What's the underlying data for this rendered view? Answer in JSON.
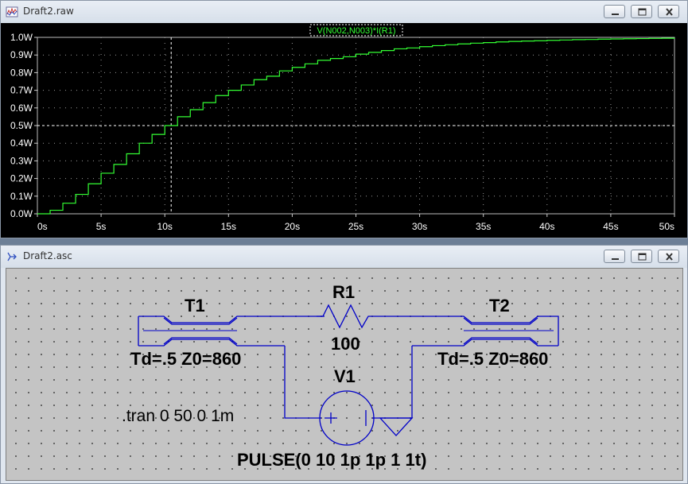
{
  "plot_window": {
    "title": "Draft2.raw",
    "trace_label": "V(N002,N003)*I(R1)",
    "colors": {
      "background": "#000000",
      "trace": "#33ff33",
      "axis_text": "#ffffff",
      "grid": "#9a9a9a"
    }
  },
  "chart_data": {
    "type": "line",
    "title": "",
    "xlabel": "",
    "ylabel": "",
    "xlim": [
      0,
      50
    ],
    "ylim": [
      0,
      1.0
    ],
    "x_ticks": [
      "0s",
      "5s",
      "10s",
      "15s",
      "20s",
      "25s",
      "30s",
      "35s",
      "40s",
      "45s",
      "50s"
    ],
    "y_ticks": [
      "0.0W",
      "0.1W",
      "0.2W",
      "0.3W",
      "0.4W",
      "0.5W",
      "0.6W",
      "0.7W",
      "0.8W",
      "0.9W",
      "1.0W"
    ],
    "grid": true,
    "cursor_x": 10.5,
    "cursor_y": 0.5,
    "series": [
      {
        "name": "V(N002,N003)*I(R1)",
        "color": "#33ff33",
        "x": [
          0,
          1,
          2,
          3,
          4,
          5,
          6,
          7,
          8,
          9,
          10,
          11,
          12,
          13,
          14,
          15,
          16,
          17,
          18,
          19,
          20,
          21,
          22,
          23,
          24,
          25,
          26,
          27,
          28,
          29,
          30,
          31,
          32,
          33,
          34,
          35,
          36,
          37,
          38,
          39,
          40,
          41,
          42,
          43,
          44,
          45,
          46,
          47,
          48,
          49,
          50
        ],
        "y": [
          0,
          0.02,
          0.06,
          0.11,
          0.17,
          0.23,
          0.28,
          0.34,
          0.4,
          0.45,
          0.5,
          0.55,
          0.59,
          0.63,
          0.67,
          0.7,
          0.73,
          0.76,
          0.78,
          0.81,
          0.83,
          0.85,
          0.87,
          0.88,
          0.89,
          0.905,
          0.915,
          0.925,
          0.935,
          0.94,
          0.947,
          0.953,
          0.958,
          0.963,
          0.967,
          0.97,
          0.974,
          0.977,
          0.979,
          0.981,
          0.983,
          0.985,
          0.987,
          0.988,
          0.99,
          0.991,
          0.992,
          0.993,
          0.994,
          0.995,
          0.996
        ]
      }
    ]
  },
  "schematic_window": {
    "title": "Draft2.asc",
    "components": {
      "r1_name": "R1",
      "r1_value": "100",
      "t1_name": "T1",
      "t1_params": "Td=.5 Z0=860",
      "t2_name": "T2",
      "t2_params": "Td=.5 Z0=860",
      "v1_name": "V1",
      "v1_value": "PULSE(0 10 1p 1p 1 1t)",
      "directive": ".tran 0 50 0 1m"
    },
    "colors": {
      "canvas": "#c4c4c4",
      "wire": "#0000c8",
      "text": "#000000"
    }
  },
  "window_buttons": {
    "minimize": "minimize-icon",
    "restore": "restore-icon",
    "close": "close-icon"
  }
}
